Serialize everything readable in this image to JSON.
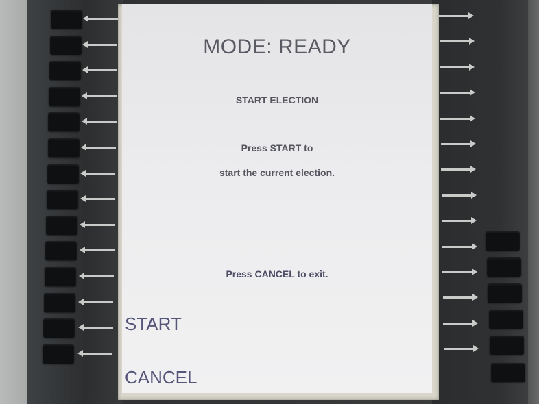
{
  "screen": {
    "mode_title": "MODE: READY",
    "heading": "START ELECTION",
    "instruction_line1": "Press START to",
    "instruction_line2": "start the current election.",
    "cancel_instruction": "Press CANCEL to exit."
  },
  "softkeys": {
    "start_label": "START",
    "cancel_label": "CANCEL"
  },
  "colors": {
    "screen_background": "#ececee",
    "screen_text": "#55555e",
    "softkey_label": "#55567a",
    "hardware_button": "#0f1012",
    "arrow": "#c8cbc8"
  },
  "icons": {
    "left_arrows": "arrow-left-icon",
    "right_arrows": "arrow-right-icon"
  }
}
